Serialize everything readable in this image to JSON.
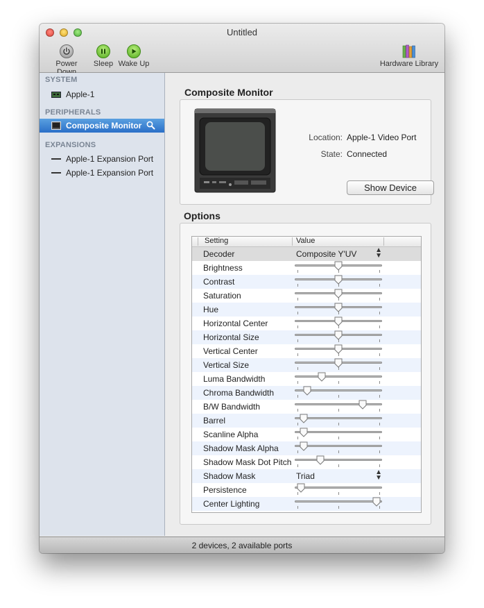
{
  "window": {
    "title": "Untitled"
  },
  "toolbar": {
    "power_down": "Power Down",
    "sleep": "Sleep",
    "wake_up": "Wake Up",
    "hardware_library": "Hardware Library"
  },
  "sidebar": {
    "system_header": "SYSTEM",
    "system_items": [
      {
        "label": "Apple-1"
      }
    ],
    "peripherals_header": "PERIPHERALS",
    "peripheral_items": [
      {
        "label": "Composite Monitor",
        "selected": true
      }
    ],
    "expansions_header": "EXPANSIONS",
    "expansion_items": [
      {
        "label": "Apple-1 Expansion Port"
      },
      {
        "label": "Apple-1 Expansion Port"
      }
    ]
  },
  "device": {
    "title": "Composite Monitor",
    "location_label": "Location:",
    "location_value": "Apple-1 Video Port",
    "state_label": "State:",
    "state_value": "Connected",
    "show_button": "Show Device"
  },
  "options": {
    "title": "Options",
    "col_setting": "Setting",
    "col_value": "Value",
    "rows": [
      {
        "setting": "Decoder",
        "type": "popup",
        "value": "Composite Y'UV"
      },
      {
        "setting": "Brightness",
        "type": "slider",
        "level": 0.5
      },
      {
        "setting": "Contrast",
        "type": "slider",
        "level": 0.5
      },
      {
        "setting": "Saturation",
        "type": "slider",
        "level": 0.5
      },
      {
        "setting": "Hue",
        "type": "slider",
        "level": 0.5
      },
      {
        "setting": "Horizontal Center",
        "type": "slider",
        "level": 0.5
      },
      {
        "setting": "Horizontal Size",
        "type": "slider",
        "level": 0.5
      },
      {
        "setting": "Vertical Center",
        "type": "slider",
        "level": 0.5
      },
      {
        "setting": "Vertical Size",
        "type": "slider",
        "level": 0.5
      },
      {
        "setting": "Luma Bandwidth",
        "type": "slider",
        "level": 0.3
      },
      {
        "setting": "Chroma Bandwidth",
        "type": "slider",
        "level": 0.12
      },
      {
        "setting": "B/W Bandwidth",
        "type": "slider",
        "level": 0.8
      },
      {
        "setting": "Barrel",
        "type": "slider",
        "level": 0.08
      },
      {
        "setting": "Scanline Alpha",
        "type": "slider",
        "level": 0.08
      },
      {
        "setting": "Shadow Mask Alpha",
        "type": "slider",
        "level": 0.08
      },
      {
        "setting": "Shadow Mask Dot Pitch",
        "type": "slider",
        "level": 0.28
      },
      {
        "setting": "Shadow Mask",
        "type": "popup",
        "value": "Triad"
      },
      {
        "setting": "Persistence",
        "type": "slider",
        "level": 0.04
      },
      {
        "setting": "Center Lighting",
        "type": "slider",
        "level": 0.97
      }
    ]
  },
  "status": {
    "text": "2 devices, 2 available ports"
  },
  "colors": {
    "selection": "#2a6fc8",
    "sidebar_bg": "#dde3ec",
    "alt_row": "#edf3fd"
  }
}
